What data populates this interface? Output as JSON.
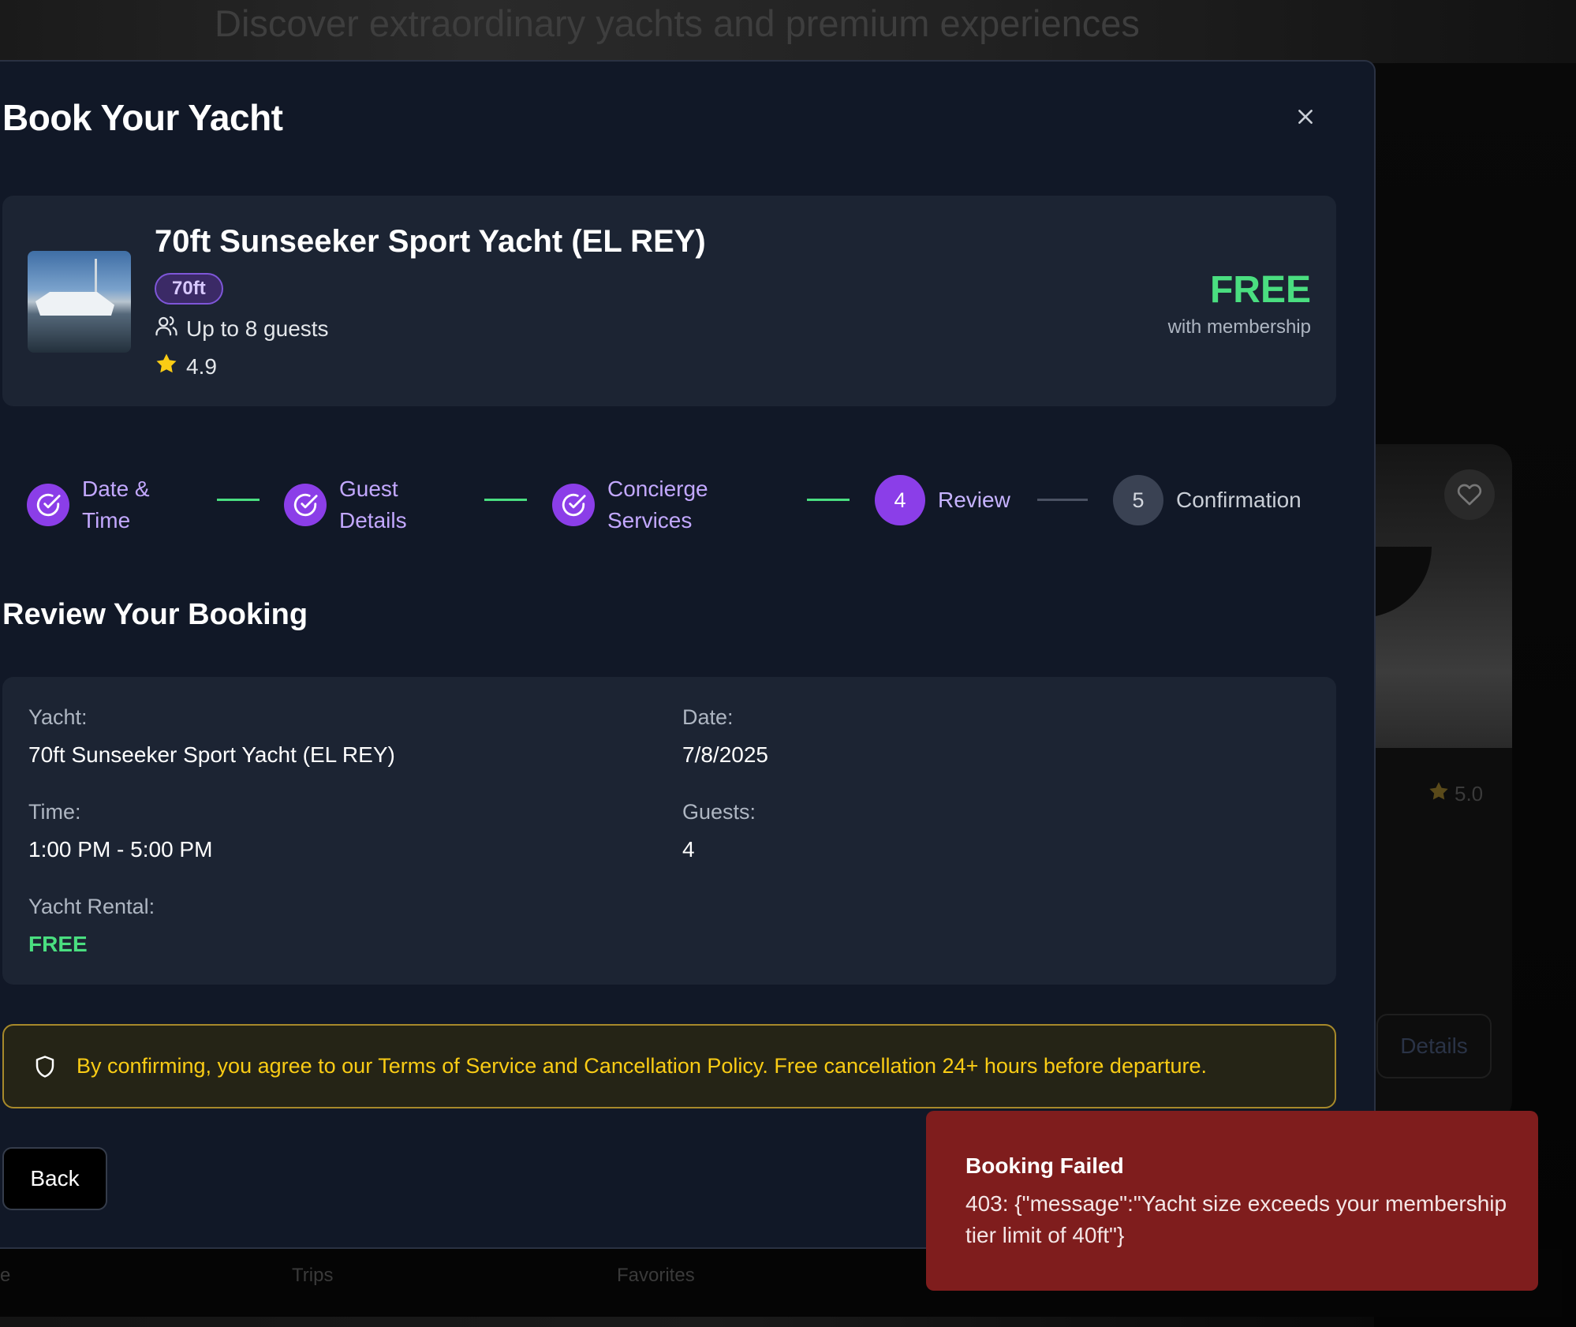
{
  "background": {
    "tagline": "Discover extraordinary yachts and premium experiences",
    "card": {
      "rating": "5.0",
      "details_label": "Details",
      "fav_icon": "heart-icon"
    },
    "tabs": [
      "e",
      "Trips",
      "Favorites"
    ]
  },
  "modal": {
    "title": "Book Your Yacht",
    "close_icon": "close-icon"
  },
  "yacht": {
    "name": "70ft Sunseeker Sport Yacht (EL REY)",
    "size_badge": "70ft",
    "guests": "Up to 8 guests",
    "rating": "4.9",
    "price": "FREE",
    "price_sub": "with membership"
  },
  "stepper": {
    "steps": [
      {
        "label_line1": "Date &",
        "label_line2": "Time",
        "state": "completed"
      },
      {
        "label_line1": "Guest",
        "label_line2": "Details",
        "state": "completed"
      },
      {
        "label_line1": "Concierge",
        "label_line2": "Services",
        "state": "completed"
      },
      {
        "number": "4",
        "label": "Review",
        "state": "active"
      },
      {
        "number": "5",
        "label": "Confirmation",
        "state": "pending"
      }
    ]
  },
  "review": {
    "title": "Review Your Booking",
    "yacht_label": "Yacht:",
    "yacht_value": "70ft Sunseeker Sport Yacht (EL REY)",
    "date_label": "Date:",
    "date_value": "7/8/2025",
    "time_label": "Time:",
    "time_value": "1:00 PM - 5:00 PM",
    "guests_label": "Guests:",
    "guests_value": "4",
    "rental_label": "Yacht Rental:",
    "rental_value": "FREE"
  },
  "notice": {
    "text": "By confirming, you agree to our Terms of Service and Cancellation Policy. Free cancellation 24+ hours before departure.",
    "icon": "shield-icon"
  },
  "actions": {
    "back_label": "Back"
  },
  "toast": {
    "title": "Booking Failed",
    "message": "403: {\"message\":\"Yacht size exceeds your membership tier limit of 40ft\"}"
  },
  "colors": {
    "modal_bg": "#111827",
    "card_bg": "#1c2433",
    "accent_purple": "#8b3ee8",
    "success_green": "#4ade80",
    "warning_yellow": "#facc15",
    "error_red": "#7f1d1d"
  }
}
